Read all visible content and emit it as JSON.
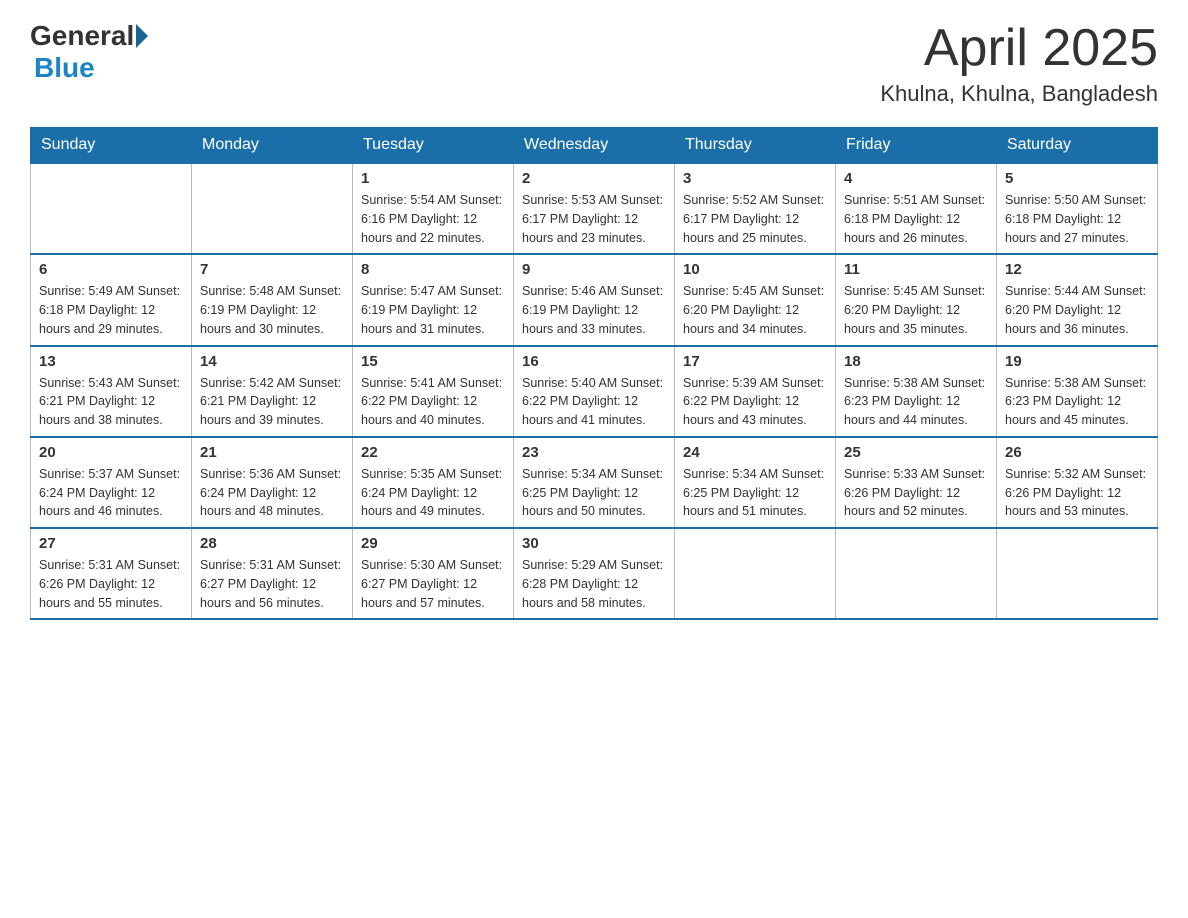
{
  "header": {
    "logo_general": "General",
    "logo_blue": "Blue",
    "month_title": "April 2025",
    "location": "Khulna, Khulna, Bangladesh"
  },
  "days_of_week": [
    "Sunday",
    "Monday",
    "Tuesday",
    "Wednesday",
    "Thursday",
    "Friday",
    "Saturday"
  ],
  "weeks": [
    [
      {
        "day": "",
        "info": ""
      },
      {
        "day": "",
        "info": ""
      },
      {
        "day": "1",
        "info": "Sunrise: 5:54 AM\nSunset: 6:16 PM\nDaylight: 12 hours\nand 22 minutes."
      },
      {
        "day": "2",
        "info": "Sunrise: 5:53 AM\nSunset: 6:17 PM\nDaylight: 12 hours\nand 23 minutes."
      },
      {
        "day": "3",
        "info": "Sunrise: 5:52 AM\nSunset: 6:17 PM\nDaylight: 12 hours\nand 25 minutes."
      },
      {
        "day": "4",
        "info": "Sunrise: 5:51 AM\nSunset: 6:18 PM\nDaylight: 12 hours\nand 26 minutes."
      },
      {
        "day": "5",
        "info": "Sunrise: 5:50 AM\nSunset: 6:18 PM\nDaylight: 12 hours\nand 27 minutes."
      }
    ],
    [
      {
        "day": "6",
        "info": "Sunrise: 5:49 AM\nSunset: 6:18 PM\nDaylight: 12 hours\nand 29 minutes."
      },
      {
        "day": "7",
        "info": "Sunrise: 5:48 AM\nSunset: 6:19 PM\nDaylight: 12 hours\nand 30 minutes."
      },
      {
        "day": "8",
        "info": "Sunrise: 5:47 AM\nSunset: 6:19 PM\nDaylight: 12 hours\nand 31 minutes."
      },
      {
        "day": "9",
        "info": "Sunrise: 5:46 AM\nSunset: 6:19 PM\nDaylight: 12 hours\nand 33 minutes."
      },
      {
        "day": "10",
        "info": "Sunrise: 5:45 AM\nSunset: 6:20 PM\nDaylight: 12 hours\nand 34 minutes."
      },
      {
        "day": "11",
        "info": "Sunrise: 5:45 AM\nSunset: 6:20 PM\nDaylight: 12 hours\nand 35 minutes."
      },
      {
        "day": "12",
        "info": "Sunrise: 5:44 AM\nSunset: 6:20 PM\nDaylight: 12 hours\nand 36 minutes."
      }
    ],
    [
      {
        "day": "13",
        "info": "Sunrise: 5:43 AM\nSunset: 6:21 PM\nDaylight: 12 hours\nand 38 minutes."
      },
      {
        "day": "14",
        "info": "Sunrise: 5:42 AM\nSunset: 6:21 PM\nDaylight: 12 hours\nand 39 minutes."
      },
      {
        "day": "15",
        "info": "Sunrise: 5:41 AM\nSunset: 6:22 PM\nDaylight: 12 hours\nand 40 minutes."
      },
      {
        "day": "16",
        "info": "Sunrise: 5:40 AM\nSunset: 6:22 PM\nDaylight: 12 hours\nand 41 minutes."
      },
      {
        "day": "17",
        "info": "Sunrise: 5:39 AM\nSunset: 6:22 PM\nDaylight: 12 hours\nand 43 minutes."
      },
      {
        "day": "18",
        "info": "Sunrise: 5:38 AM\nSunset: 6:23 PM\nDaylight: 12 hours\nand 44 minutes."
      },
      {
        "day": "19",
        "info": "Sunrise: 5:38 AM\nSunset: 6:23 PM\nDaylight: 12 hours\nand 45 minutes."
      }
    ],
    [
      {
        "day": "20",
        "info": "Sunrise: 5:37 AM\nSunset: 6:24 PM\nDaylight: 12 hours\nand 46 minutes."
      },
      {
        "day": "21",
        "info": "Sunrise: 5:36 AM\nSunset: 6:24 PM\nDaylight: 12 hours\nand 48 minutes."
      },
      {
        "day": "22",
        "info": "Sunrise: 5:35 AM\nSunset: 6:24 PM\nDaylight: 12 hours\nand 49 minutes."
      },
      {
        "day": "23",
        "info": "Sunrise: 5:34 AM\nSunset: 6:25 PM\nDaylight: 12 hours\nand 50 minutes."
      },
      {
        "day": "24",
        "info": "Sunrise: 5:34 AM\nSunset: 6:25 PM\nDaylight: 12 hours\nand 51 minutes."
      },
      {
        "day": "25",
        "info": "Sunrise: 5:33 AM\nSunset: 6:26 PM\nDaylight: 12 hours\nand 52 minutes."
      },
      {
        "day": "26",
        "info": "Sunrise: 5:32 AM\nSunset: 6:26 PM\nDaylight: 12 hours\nand 53 minutes."
      }
    ],
    [
      {
        "day": "27",
        "info": "Sunrise: 5:31 AM\nSunset: 6:26 PM\nDaylight: 12 hours\nand 55 minutes."
      },
      {
        "day": "28",
        "info": "Sunrise: 5:31 AM\nSunset: 6:27 PM\nDaylight: 12 hours\nand 56 minutes."
      },
      {
        "day": "29",
        "info": "Sunrise: 5:30 AM\nSunset: 6:27 PM\nDaylight: 12 hours\nand 57 minutes."
      },
      {
        "day": "30",
        "info": "Sunrise: 5:29 AM\nSunset: 6:28 PM\nDaylight: 12 hours\nand 58 minutes."
      },
      {
        "day": "",
        "info": ""
      },
      {
        "day": "",
        "info": ""
      },
      {
        "day": "",
        "info": ""
      }
    ]
  ]
}
